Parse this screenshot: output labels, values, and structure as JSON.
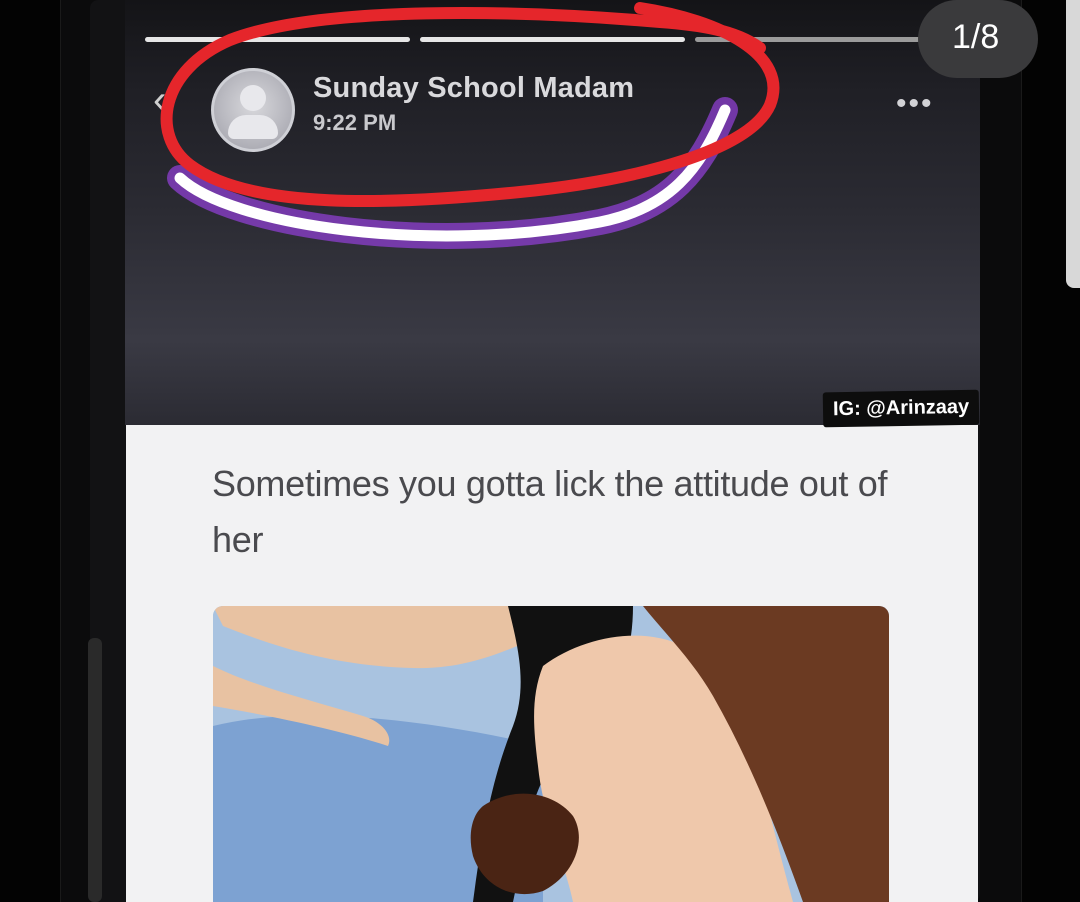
{
  "viewer": {
    "page_counter": "1/8"
  },
  "story": {
    "poster_name": "Sunday School Madam",
    "poster_time": "9:22 PM",
    "icons": [
      "back-chevron-icon",
      "more-options-icon",
      "avatar-placeholder-icon"
    ]
  },
  "watermark": {
    "text": "IG: @Arinzaay"
  },
  "post": {
    "text": "Sometimes you gotta lick the attitude out of her"
  },
  "colors": {
    "annotation_red": "#e5262b",
    "annotation_purple": "#8e3fd0",
    "annotation_white": "#ffffff",
    "card_bg": "#f2f2f3"
  }
}
